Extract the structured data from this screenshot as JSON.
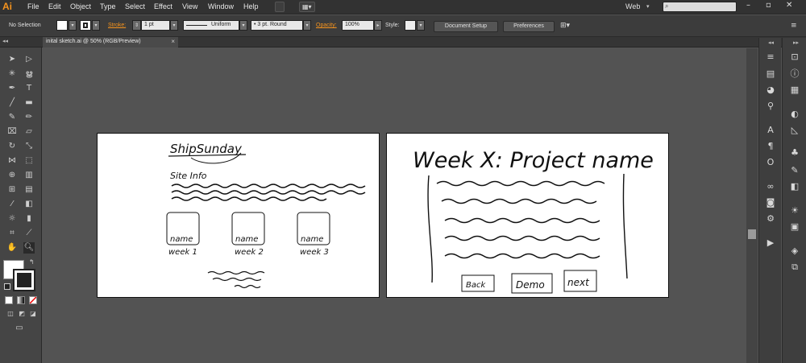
{
  "app": {
    "logo": "Ai"
  },
  "menu": [
    "File",
    "Edit",
    "Object",
    "Type",
    "Select",
    "Effect",
    "View",
    "Window",
    "Help"
  ],
  "workspace": {
    "label": "Web"
  },
  "search": {
    "placeholder": ""
  },
  "control": {
    "selection": "No Selection",
    "stroke_label": "Stroke:",
    "stroke_weight": "1 pt",
    "profile": "Uniform",
    "brush": "3 pt. Round",
    "opacity_label": "Opacity:",
    "opacity": "100%",
    "style_label": "Style:",
    "doc_setup": "Document Setup",
    "preferences": "Preferences"
  },
  "document": {
    "tab_title": "inital sketch.ai @ 50% (RGB/Preview)",
    "close": "×"
  },
  "artboard1": {
    "title": "ShipSunday",
    "subtitle": "Site Info",
    "cards": [
      {
        "label": "name",
        "caption": "week 1"
      },
      {
        "label": "name",
        "caption": "week 2"
      },
      {
        "label": "name",
        "caption": "week 3"
      }
    ]
  },
  "artboard2": {
    "title": "Week X: Project name",
    "buttons": [
      "Back",
      "Demo",
      "next"
    ]
  },
  "colors": {
    "accent": "#f7941d",
    "ui_dark": "#323232",
    "canvas": "#535353"
  }
}
